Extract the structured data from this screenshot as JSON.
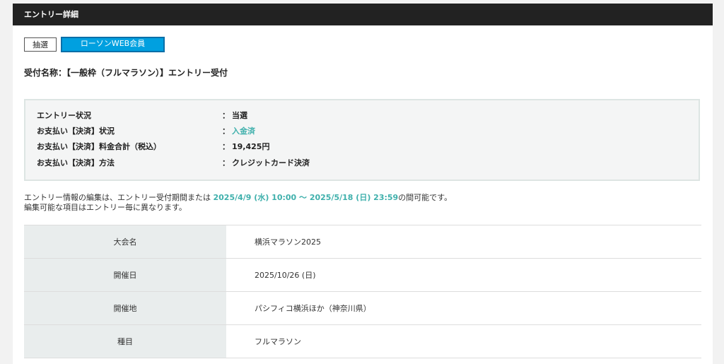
{
  "header": {
    "title": "エントリー詳細"
  },
  "tabs": [
    {
      "label": "抽選"
    },
    {
      "label": "ローソンWEB会員"
    }
  ],
  "reception": {
    "text": "受付名称：【一般枠（フルマラソン）】エントリー受付"
  },
  "status": {
    "rows": [
      {
        "label": "エントリー状況",
        "value": "当選"
      },
      {
        "label": "お支払い【決済】状況",
        "value": "入金済"
      },
      {
        "label": "お支払い【決済】料金合計（税込）",
        "value": "19,425円"
      },
      {
        "label": "お支払い【決済】方法",
        "value": "クレジットカード決済"
      }
    ],
    "colon": "："
  },
  "notice": {
    "line1_prefix": "エントリー情報の編集は、エントリー受付期間または",
    "period": "2025/4/9 (水) 10:00 ～ 2025/5/18 (日) 23:59",
    "line1_suffix": "の間可能です。",
    "line2": "編集可能な項目はエントリー毎に異なります。"
  },
  "details": [
    {
      "label": "大会名",
      "value": "横浜マラソン2025"
    },
    {
      "label": "開催日",
      "value": "2025/10/26 (日)"
    },
    {
      "label": "開催地",
      "value": "パシフィコ横浜ほか（神奈川県）"
    },
    {
      "label": "種目",
      "value": "フルマラソン"
    }
  ],
  "colors": {
    "header_bg": "#222222",
    "tab_active_bg": "#00a0e0",
    "accent_teal": "#3fb0ac",
    "table_label_bg": "#e9eded"
  }
}
